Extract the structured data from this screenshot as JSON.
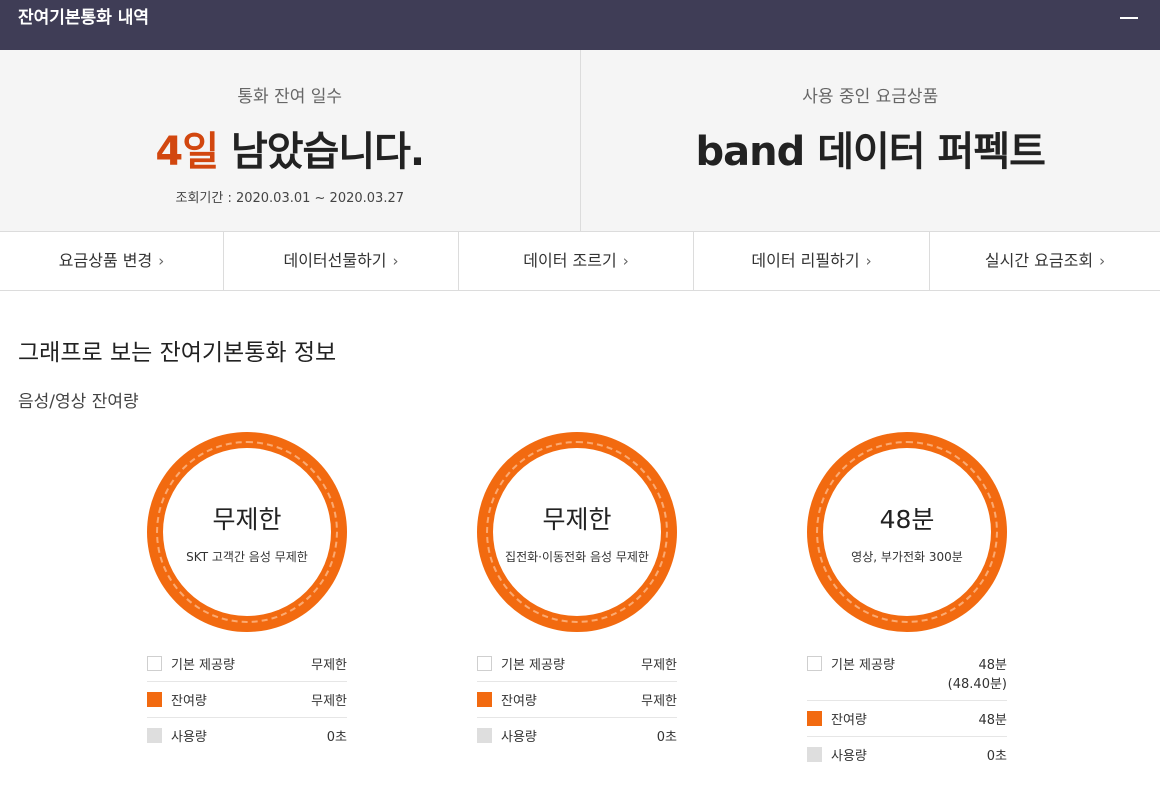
{
  "header": {
    "title": "잔여기본통화 내역"
  },
  "summary": {
    "left": {
      "label": "통화 잔여 일수",
      "days": "4일",
      "suffix": "남았습니다.",
      "period": "조회기간 : 2020.03.01 ~ 2020.03.27"
    },
    "right": {
      "label": "사용 중인 요금상품",
      "plan": "band 데이터 퍼펙트"
    }
  },
  "nav": [
    {
      "label": "요금상품 변경"
    },
    {
      "label": "데이터선물하기"
    },
    {
      "label": "데이터 조르기"
    },
    {
      "label": "데이터 리필하기"
    },
    {
      "label": "실시간 요금조회"
    }
  ],
  "section": {
    "title": "그래프로 보는 잔여기본통화 정보",
    "sub_title": "음성/영상 잔여량"
  },
  "gauges": [
    {
      "value": "무제한",
      "caption": "SKT 고객간 음성 무제한",
      "legend": {
        "base_label": "기본 제공량",
        "base_value": "무제한",
        "base_value2": "",
        "remain_label": "잔여량",
        "remain_value": "무제한",
        "used_label": "사용량",
        "used_value": "0초"
      }
    },
    {
      "value": "무제한",
      "caption": "집전화·이동전화 음성 무제한",
      "legend": {
        "base_label": "기본 제공량",
        "base_value": "무제한",
        "base_value2": "",
        "remain_label": "잔여량",
        "remain_value": "무제한",
        "used_label": "사용량",
        "used_value": "0초"
      }
    },
    {
      "value": "48분",
      "caption": "영상, 부가전화 300분",
      "legend": {
        "base_label": "기본 제공량",
        "base_value": "48분",
        "base_value2": "(48.40분)",
        "remain_label": "잔여량",
        "remain_value": "48분",
        "used_label": "사용량",
        "used_value": "0초"
      }
    }
  ],
  "colors": {
    "header_bg": "#3f3d56",
    "accent": "#d2470f",
    "ring": "#f26a10"
  },
  "icons": {
    "menu": "menu-icon",
    "chevron": "chevron-right-icon"
  }
}
